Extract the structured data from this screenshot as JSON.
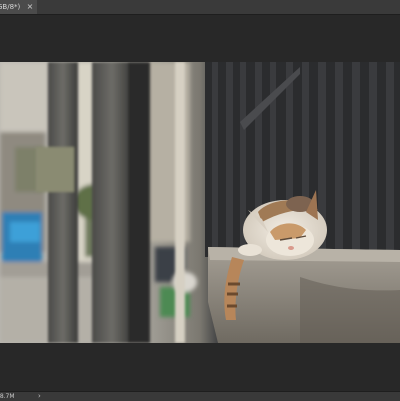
{
  "tab": {
    "title": "GB/8*)",
    "close_glyph": "×"
  },
  "document": {
    "image_description_icon": "photo-canvas",
    "colors": {
      "workspace_bg": "#282828",
      "tabbar_bg": "#3a3a3a",
      "active_tab_bg": "#4b4b4b",
      "statusbar_bg": "#393939"
    }
  },
  "status": {
    "doc_size": "68.7M",
    "arrow_glyph": "›"
  }
}
